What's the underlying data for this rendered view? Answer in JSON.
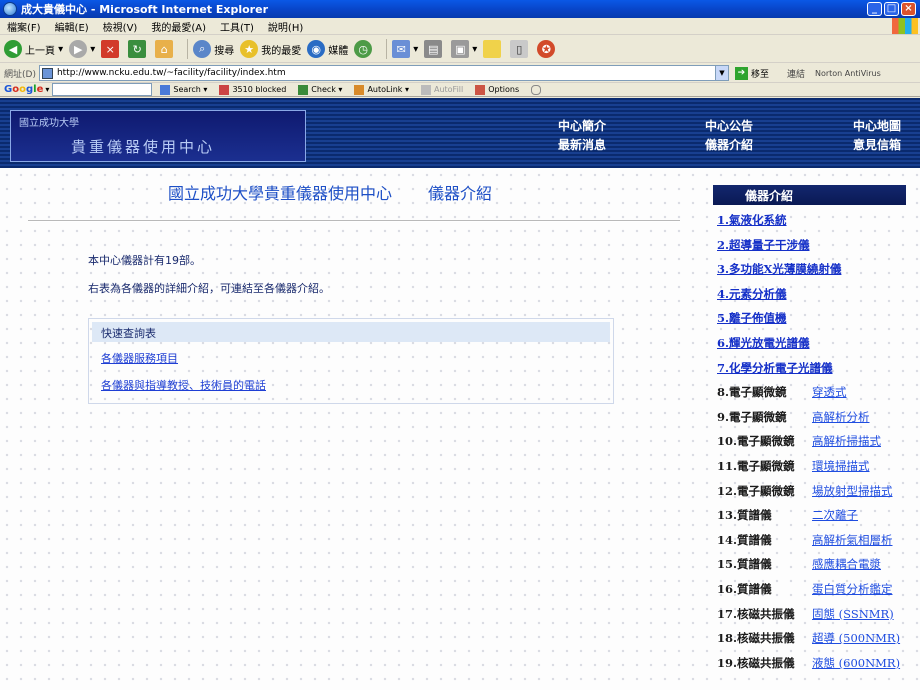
{
  "window": {
    "title": "成大貴儀中心 - Microsoft Internet Explorer"
  },
  "menu": [
    "檔案(F)",
    "編輯(E)",
    "檢視(V)",
    "我的最愛(A)",
    "工具(T)",
    "說明(H)"
  ],
  "toolbar": {
    "back": "上一頁",
    "search": "搜尋",
    "favorites": "我的最愛",
    "media": "媒體"
  },
  "address": {
    "label": "網址(D)",
    "url": "http://www.ncku.edu.tw/~facility/facility/index.htm",
    "go": "移至",
    "links": "連結",
    "norton": "Norton AntiVirus"
  },
  "googlebar": {
    "logo": "Google",
    "search": "Search",
    "blocked": "3510 blocked",
    "check": "Check",
    "autolink": "AutoLink",
    "autofill": "AutoFill",
    "options": "Options"
  },
  "site": {
    "logo_small": "國立成功大學",
    "logo_big": "貴重儀器使用中心",
    "nav": [
      "中心簡介",
      "中心公告",
      "中心地圖",
      "最新消息",
      "儀器介紹",
      "意見信箱"
    ],
    "title_left": "國立成功大學貴重儀器使用中心",
    "title_right": "儀器介紹",
    "count_text": "本中心儀器計有19部。",
    "desc_text": "右表為各儀器的詳細介紹，可連結至各儀器介紹。",
    "quick": {
      "header": "快速查詢表",
      "links": [
        "各儀器服務項目",
        "各儀器與指導教授、技術員的電話"
      ]
    },
    "sidebar_title": "儀器介紹",
    "instruments_full": [
      {
        "num": "1.",
        "label": "氣液化系統"
      },
      {
        "num": "2.",
        "label": "超導量子干涉儀"
      },
      {
        "num": "",
        "label": "3.多功能X光薄膜繞射儀"
      },
      {
        "num": "4.",
        "label": "元素分析儀"
      },
      {
        "num": "5.",
        "label": "離子佈值機"
      },
      {
        "num": "6.",
        "label": "輝光放電光譜儀"
      },
      {
        "num": "7.",
        "label": "化學分析電子光譜儀"
      }
    ],
    "instruments_sub": [
      {
        "label": "8.電子顯微鏡",
        "sub": "穿透式"
      },
      {
        "label": "9.電子顯微鏡",
        "sub": "高解析分析"
      },
      {
        "label": "10.電子顯微鏡",
        "sub": "高解析掃描式"
      },
      {
        "label": "11.電子顯微鏡",
        "sub": "環境掃描式"
      },
      {
        "label": "12.電子顯微鏡",
        "sub": "場放射型掃描式"
      },
      {
        "label": "13.質譜儀",
        "sub": "二次離子"
      },
      {
        "label": "14.質譜儀",
        "sub": "高解析氣相層析"
      },
      {
        "label": "15.質譜儀",
        "sub": "感應耦合電漿"
      },
      {
        "label": "16.質譜儀",
        "sub": "蛋白質分析鑑定"
      },
      {
        "label": "17.核磁共振儀",
        "sub": "固態 (SSNMR)"
      },
      {
        "label": "18.核磁共振儀",
        "sub": "超導 (500NMR)"
      },
      {
        "label": "19.核磁共振儀",
        "sub": "液態 (600NMR)"
      }
    ]
  }
}
